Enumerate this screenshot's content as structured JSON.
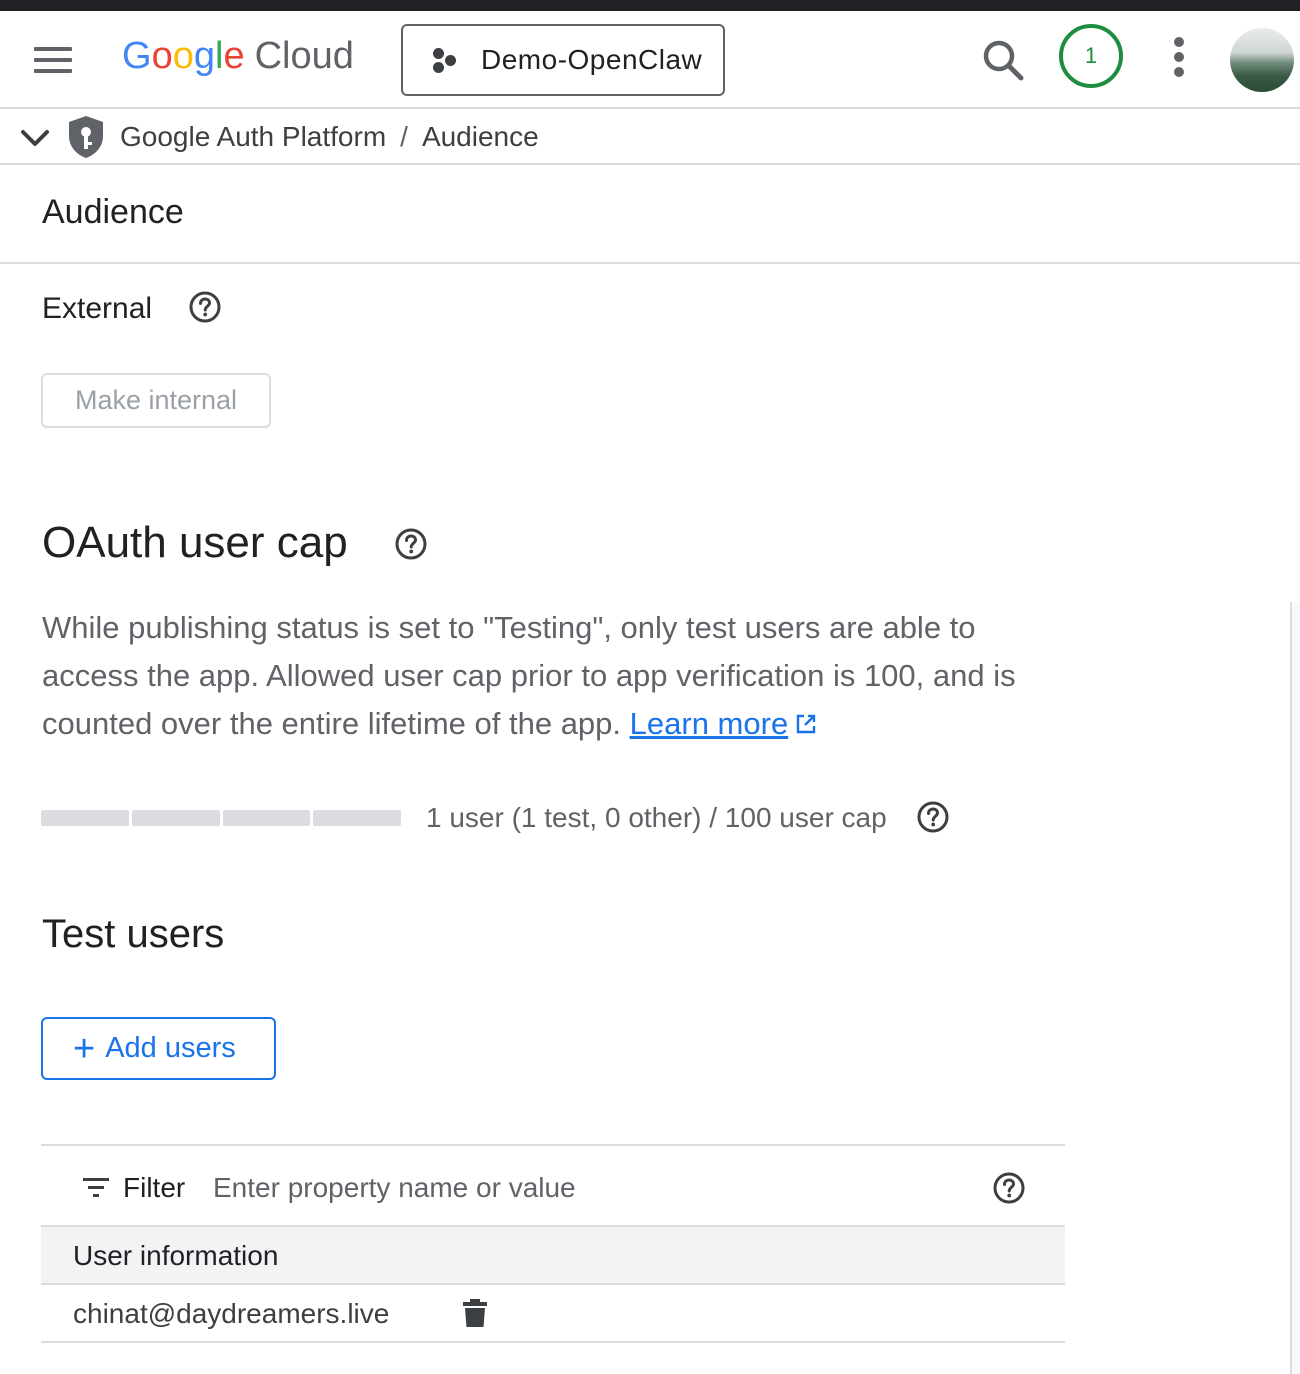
{
  "header": {
    "logo_google": "Google",
    "logo_cloud": "Cloud",
    "project_name": "Demo-OpenClaw",
    "notification_count": "1"
  },
  "breadcrumb": {
    "product": "Google Auth Platform",
    "separator": "/",
    "page": "Audience"
  },
  "page": {
    "title": "Audience",
    "user_type": "External",
    "make_internal_label": "Make internal"
  },
  "oauth_cap": {
    "title": "OAuth user cap",
    "description": "While publishing status is set to \"Testing\", only test users are able to access the app. Allowed user cap prior to app verification is 100, and is counted over the entire lifetime of the app.",
    "learn_more": "Learn more",
    "usage_text": "1 user (1 test, 0 other) / 100 user cap",
    "used": 1,
    "cap": 100
  },
  "test_users": {
    "title": "Test users",
    "add_label": "Add users",
    "filter_label": "Filter",
    "filter_placeholder": "Enter property name or value",
    "column_header": "User information",
    "rows": [
      "chinat@daydreamers.live"
    ]
  },
  "colors": {
    "accent": "#1a73e8",
    "notification": "#1e8e3e",
    "google_blue": "#4285f4",
    "google_red": "#ea4335",
    "google_yellow": "#fbbc04",
    "google_green": "#34a853"
  }
}
